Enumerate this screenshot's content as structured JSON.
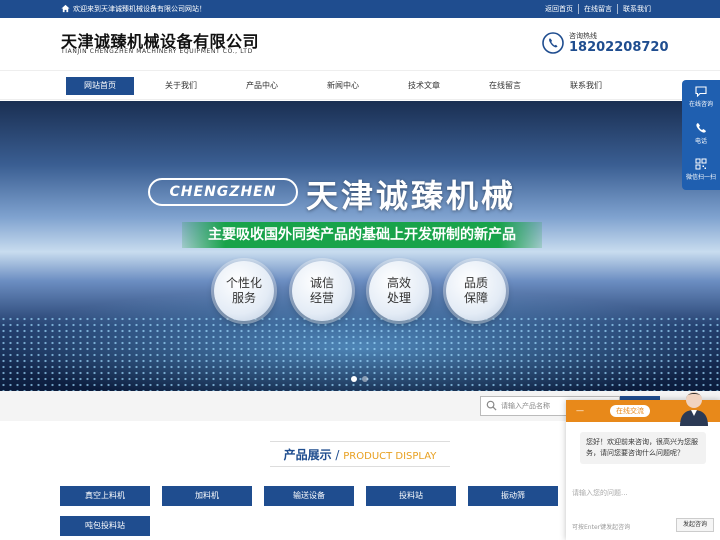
{
  "topbar": {
    "welcome": "欢迎来到天津诚臻机械设备有限公司网站！",
    "links": [
      "返回首页",
      "在线留言",
      "联系我们"
    ]
  },
  "header": {
    "company_cn": "天津诚臻机械设备有限公司",
    "company_en": "TIANJIN CHENGZHEN MACHINERY EQUIPMENT CO., LTD",
    "hotline_label": "咨询热线",
    "hotline_number": "18202208720"
  },
  "nav": {
    "items": [
      "网站首页",
      "关于我们",
      "产品中心",
      "新闻中心",
      "技术文章",
      "在线留言",
      "联系我们"
    ]
  },
  "banner": {
    "brand_en": "CHENGZHEN",
    "brand_cn": "天津诚臻机械",
    "slogan": "主要吸收国外同类产品的基础上开发研制的新产品",
    "circles": [
      {
        "line1": "个性化",
        "line2": "服务"
      },
      {
        "line1": "诚信",
        "line2": "经营"
      },
      {
        "line1": "高效",
        "line2": "处理"
      },
      {
        "line1": "品质",
        "line2": "保障"
      }
    ]
  },
  "search": {
    "placeholder": "请输入产品名称"
  },
  "section": {
    "title_cn": "产品展示",
    "separator": " / ",
    "title_en": "PRODUCT DISPLAY"
  },
  "categories": [
    "真空上料机",
    "加料机",
    "输送设备",
    "投料站",
    "振动筛",
    "吨包投料站"
  ],
  "sidebar": {
    "items": [
      "在线咨询",
      "电话",
      "微信扫一扫"
    ]
  },
  "chat": {
    "header_label": "在线交流",
    "header_dash": "—",
    "message": "您好！欢迎前来咨询，很高兴为您服务，请问您要咨询什么问题呢？",
    "input_placeholder": "请输入您的问题...",
    "tip": "可按Enter键发起咨询",
    "send_label": "发起咨询"
  },
  "colors": {
    "brand_blue": "#1f4d8f",
    "accent_orange": "#e8891a",
    "slogan_green": "#18a34a",
    "en_title_orange": "#e8a020"
  }
}
